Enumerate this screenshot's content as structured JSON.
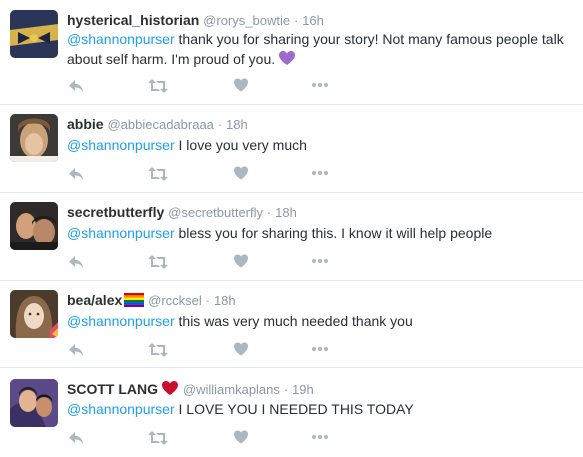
{
  "tweets": [
    {
      "name": "hysterical_historian",
      "handle": "@rorys_bowtie",
      "dot": "·",
      "time": "16h",
      "mention": "@shannonpurser",
      "text": " thank you for sharing your story! Not many famous people talk about self harm. I'm proud of you.",
      "emoji": "💜"
    },
    {
      "name": "abbie",
      "handle": "@abbiecadabraaa",
      "dot": "·",
      "time": "18h",
      "mention": "@shannonpurser",
      "text": " I love you very much"
    },
    {
      "name": "secretbutterfly",
      "handle": "@secretbutterfly",
      "dot": "·",
      "time": "18h",
      "mention": "@shannonpurser",
      "text": " bless you for sharing this. I know it will help people"
    },
    {
      "name": "bea/alex",
      "name_emoji": "rainbow-flag",
      "handle": "@rccksel",
      "dot": "·",
      "time": "18h",
      "mention": "@shannonpurser",
      "text": " this was very much needed thank you"
    },
    {
      "name": "SCOTT LANG",
      "name_emoji": "red-heart",
      "handle": "@williamkaplans",
      "dot": "·",
      "time": "19h",
      "mention": "@shannonpurser",
      "text": " I LOVE YOU I NEEDED THIS TODAY"
    }
  ],
  "actions": [
    "reply-icon",
    "retweet-icon",
    "like-icon",
    "more-icon"
  ],
  "colors": {
    "mention": "#1da1f2",
    "name": "#292f33",
    "meta": "#8899a6",
    "action_icon": "#aab8c2",
    "divider": "#e1e8ed"
  }
}
